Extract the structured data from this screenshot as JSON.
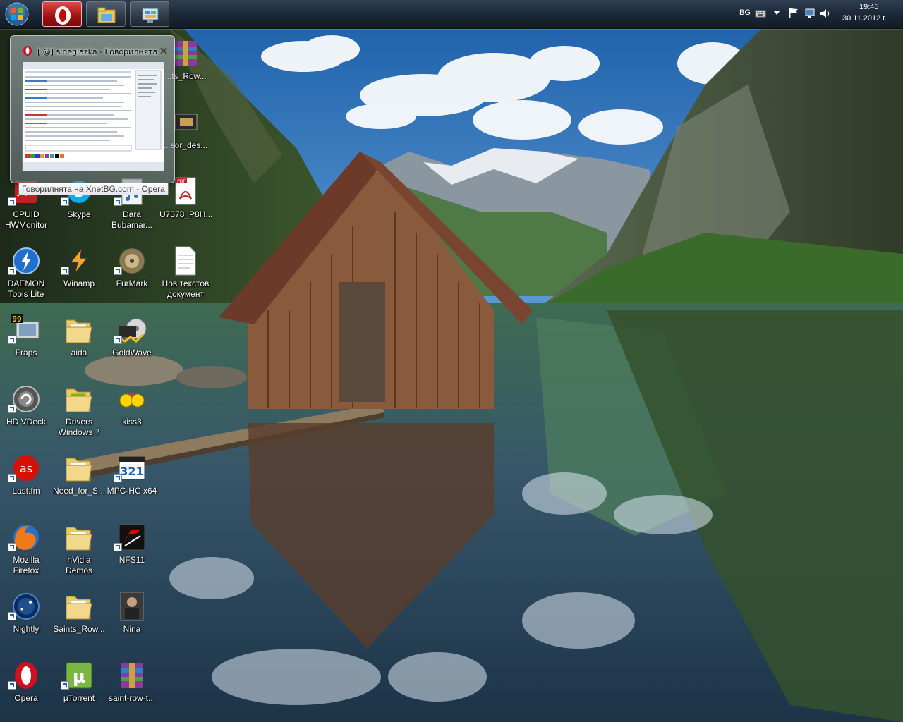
{
  "taskbar": {
    "start": {
      "icon": "windows-start-orb-icon"
    },
    "pinned": [
      {
        "name": "Opera",
        "icon": "opera-icon",
        "active": true
      },
      {
        "name": "Windows Explorer",
        "icon": "folder-library-icon",
        "active": false
      },
      {
        "name": "Control Panel",
        "icon": "control-panel-icon",
        "active": false
      }
    ],
    "tray": {
      "language": "BG",
      "time": "19:45",
      "date": "30.11.2012 г.",
      "icons": [
        "keyboard-icon",
        "show-hidden-icons-chevron",
        "action-center-flag-icon",
        "network-icon",
        "volume-icon"
      ]
    }
  },
  "preview": {
    "window_title": "[ @] sineglazka - Говорилнята ...",
    "tooltip": "Говорилнята на XnetBG.com - Opera"
  },
  "desktop_icons": [
    {
      "id": "cpuid",
      "label": "CPUID\nHWMonitor",
      "icon": "hwmonitor-icon"
    },
    {
      "id": "skype",
      "label": "Skype",
      "icon": "skype-icon"
    },
    {
      "id": "dara",
      "label": "Dara\nBubamar...",
      "icon": "music-file-icon"
    },
    {
      "id": "u7378",
      "label": "U7378_P8H...",
      "icon": "pdf-icon"
    },
    {
      "id": "daemon",
      "label": "DAEMON\nTools Lite",
      "icon": "daemon-tools-icon"
    },
    {
      "id": "winamp",
      "label": "Winamp",
      "icon": "winamp-icon"
    },
    {
      "id": "furmark",
      "label": "FurMark",
      "icon": "furmark-icon"
    },
    {
      "id": "newtext",
      "label": "Нов текстов\nдокумент",
      "icon": "text-document-icon"
    },
    {
      "id": "fraps",
      "label": "Fraps",
      "icon": "fraps-icon"
    },
    {
      "id": "aida",
      "label": "aida",
      "icon": "folder-icon"
    },
    {
      "id": "goldwave",
      "label": "GoldWave",
      "icon": "goldwave-icon"
    },
    {
      "id": "hdvdeck",
      "label": "HD VDeck",
      "icon": "hd-vdeck-icon"
    },
    {
      "id": "drivers",
      "label": "Drivers\nWindows 7",
      "icon": "folder-icon"
    },
    {
      "id": "kiss3",
      "label": "kiss3",
      "icon": "smiley-icon"
    },
    {
      "id": "lastfm",
      "label": "Last.fm",
      "icon": "lastfm-icon"
    },
    {
      "id": "nfs",
      "label": "Need_for_S...",
      "icon": "folder-icon"
    },
    {
      "id": "mpchc",
      "label": "MPC-HC x64",
      "icon": "mpc-hc-icon"
    },
    {
      "id": "firefox",
      "label": "Mozilla\nFirefox",
      "icon": "firefox-icon"
    },
    {
      "id": "nvidiademos",
      "label": "nVidia\nDemos",
      "icon": "folder-icon"
    },
    {
      "id": "nfs11",
      "label": "NFS11",
      "icon": "nfs-icon"
    },
    {
      "id": "nightly",
      "label": "Nightly",
      "icon": "nightly-icon"
    },
    {
      "id": "saintsfolder",
      "label": "Saints_Row...",
      "icon": "folder-icon"
    },
    {
      "id": "nina",
      "label": "Nina",
      "icon": "photo-icon"
    },
    {
      "id": "opera",
      "label": "Opera",
      "icon": "opera-icon"
    },
    {
      "id": "utorrent",
      "label": "µTorrent",
      "icon": "utorrent-icon"
    },
    {
      "id": "saintrar",
      "label": "saint-row-t...",
      "icon": "winrar-archive-icon"
    },
    {
      "id": "saintsrowtop",
      "label": "...ts_Row...",
      "icon": "winrar-archive-icon"
    },
    {
      "id": "sordes",
      "label": "...sor_des...",
      "icon": "cpu-icon"
    }
  ]
}
